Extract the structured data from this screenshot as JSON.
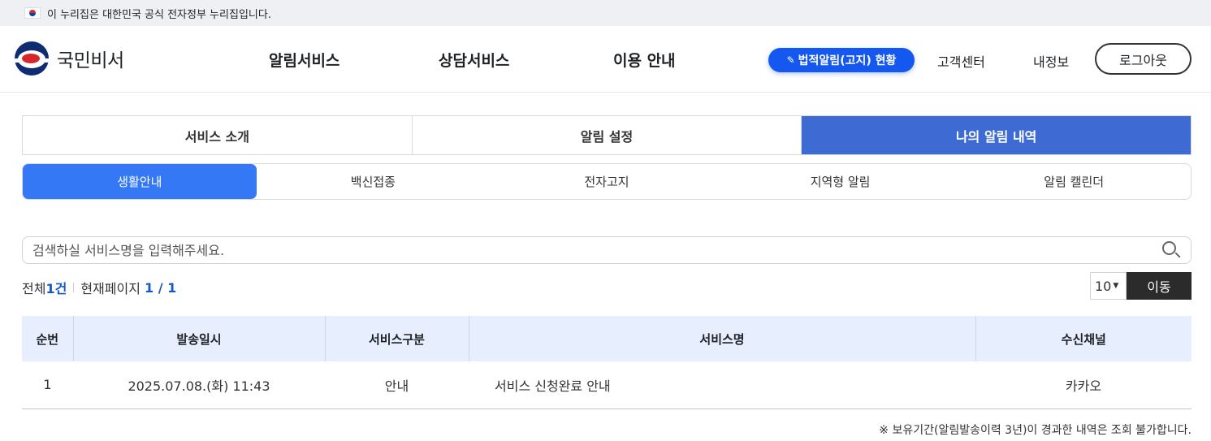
{
  "gov_banner": {
    "text": "이 누리집은 대한민국 공식 전자정부 누리집입니다."
  },
  "header": {
    "logo_text": "국민비서",
    "gnb": [
      "알림서비스",
      "상담서비스",
      "이용 안내"
    ],
    "legal_button": "법적알림(고지) 현황",
    "util": [
      "고객센터",
      "내정보"
    ],
    "logout": "로그아웃"
  },
  "tabs": [
    "서비스 소개",
    "알림 설정",
    "나의 알림 내역"
  ],
  "subtabs": [
    "생활안내",
    "백신접종",
    "전자고지",
    "지역형 알림",
    "알림 캘린더"
  ],
  "search": {
    "placeholder": "검색하실 서비스명을 입력해주세요."
  },
  "summary": {
    "total_label": "전체",
    "total_value": "1건",
    "page_label": "현재페이지",
    "page_value": "1 / 1"
  },
  "pager": {
    "per_page": "10",
    "go": "이동"
  },
  "table": {
    "headers": [
      "순번",
      "발송일시",
      "서비스구분",
      "서비스명",
      "수신채널"
    ],
    "rows": [
      [
        "1",
        "2025.07.08.(화) 11:43",
        "안내",
        "서비스 신청완료 안내",
        "카카오"
      ]
    ]
  },
  "note": "※ 보유기간(알림발송이력 3년)이 경과한 내역은 조회 불가합니다.",
  "colors": {
    "primary": "#1558f0",
    "tab_active": "#3d6bd3",
    "subtab_active": "#3478f6",
    "table_head": "#e7efff"
  }
}
